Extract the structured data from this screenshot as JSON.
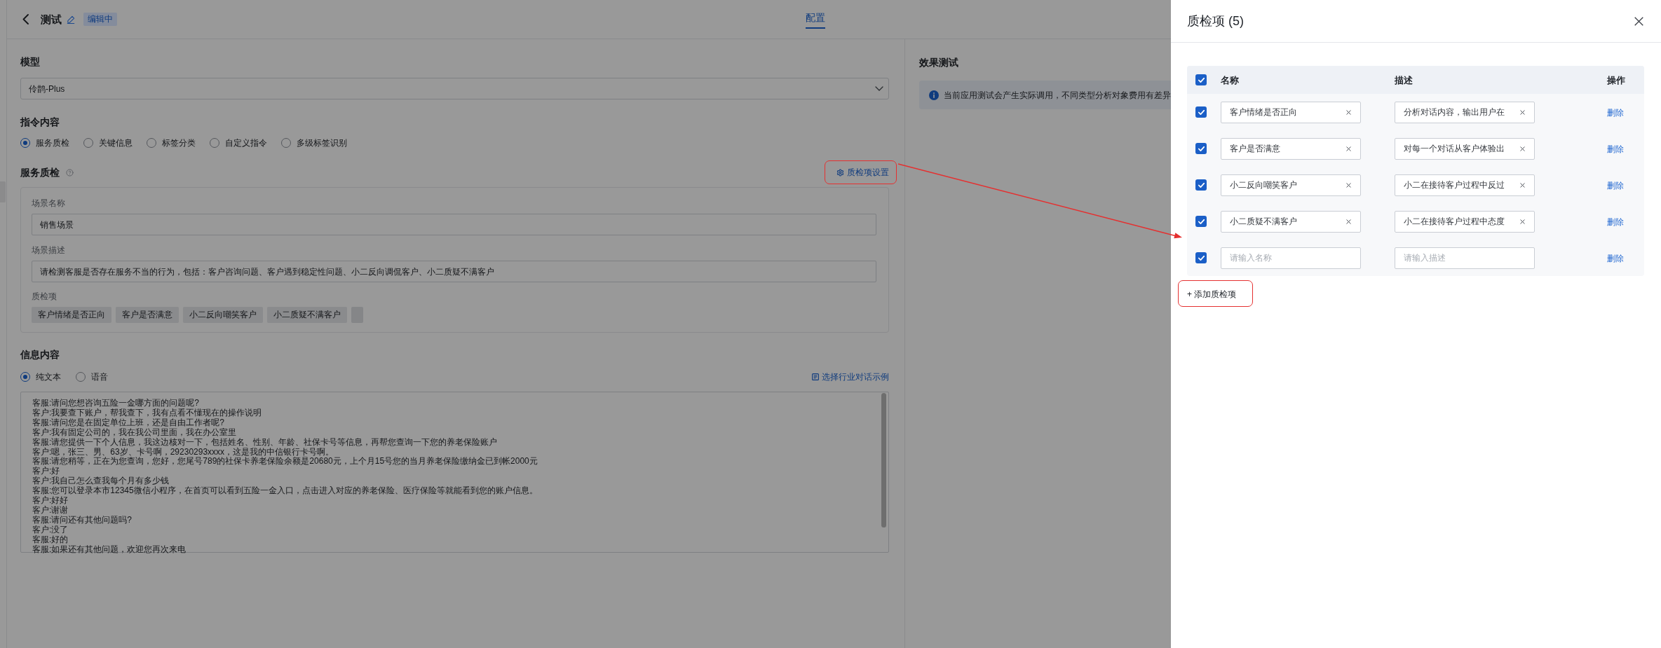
{
  "header": {
    "title": "测试",
    "badge": "编辑中",
    "tabs": [
      {
        "label": "配置",
        "selected": true
      }
    ]
  },
  "config": {
    "model": {
      "label": "模型",
      "value": "伶鹊-Plus"
    },
    "instruction": {
      "label": "指令内容",
      "options": [
        {
          "label": "服务质检",
          "selected": true
        },
        {
          "label": "关键信息",
          "selected": false
        },
        {
          "label": "标签分类",
          "selected": false
        },
        {
          "label": "自定义指令",
          "selected": false
        },
        {
          "label": "多级标签识别",
          "selected": false
        }
      ]
    },
    "service_qc": {
      "title": "服务质检",
      "settings_link": {
        "label": "质检项设置",
        "highlighted": true
      },
      "scene_name": {
        "label": "场景名称",
        "value": "销售场景"
      },
      "scene_description": {
        "label": "场景描述",
        "value": "请检测客服是否存在服务不当的行为，包括：客户咨询问题、客户遇到稳定性问题、小二反向调侃客户、小二质疑不满客户"
      },
      "items": {
        "label": "质检项",
        "tags": [
          {
            "kind": "text",
            "label": "客户情绪是否正向"
          },
          {
            "kind": "text",
            "label": "客户是否满意"
          },
          {
            "kind": "text",
            "label": "小二反向嘲笑客户"
          },
          {
            "kind": "text",
            "label": "小二质疑不满客户"
          },
          {
            "kind": "blank"
          }
        ]
      }
    },
    "message": {
      "label": "信息内容",
      "options": [
        {
          "label": "纯文本",
          "selected": true
        },
        {
          "label": "语音",
          "selected": false
        }
      ],
      "example_link": "选择行业对话示例",
      "dialogue": [
        "客服:请问您想咨询五险一金哪方面的问题呢?",
        "客户:我要查下账户，帮我查下，我有点看不懂现在的操作说明",
        "客服:请问您是在固定单位上班，还是自由工作者呢?",
        "客户:我有固定公司的，我在我公司里面，我在办公室里",
        "客服:请您提供一下个人信息，我这边核对一下，包括姓名、性别、年龄、社保卡号等信息，再帮您查询一下您的养老保险账户",
        "客户:嗯，张三、男、63岁、卡号啊，29230293xxxx，这是我的中信银行卡号啊。",
        "客服:请您稍等，正在为您查询，您好，您尾号789的社保卡养老保险余额是20680元，上个月15号您的当月养老保险缴纳金已到帐2000元",
        "客户:好",
        "客户:我自己怎么查我每个月有多少钱",
        "客服:您可以登录本市12345微信小程序，在首页可以看到五险一金入口，点击进入对应的养老保险、医疗保险等就能看到您的账户信息。",
        "客户:好好",
        "客户:谢谢",
        "客服:请问还有其他问题吗?",
        "客户:没了",
        "客服:好的",
        "客服:如果还有其他问题，欢迎您再次来电"
      ]
    }
  },
  "effect_test": {
    "title": "效果测试",
    "notice": "当前应用测试会产生实际调用，不同类型分析对象费用有差异"
  },
  "drawer": {
    "title": "质检项 (5)",
    "select_all": {
      "checked": true
    },
    "columns": [
      "名称",
      "描述",
      "操作"
    ],
    "rows": [
      {
        "checked": true,
        "name": {
          "value": "客户情绪是否正向"
        },
        "description": {
          "value": "分析对话内容，输出用户在"
        },
        "action": "删除"
      },
      {
        "checked": true,
        "name": {
          "value": "客户是否满意"
        },
        "description": {
          "value": "对每一个对话从客户体验出"
        },
        "action": "删除"
      },
      {
        "checked": true,
        "name": {
          "value": "小二反向嘲笑客户"
        },
        "description": {
          "value": "小二在接待客户过程中反过"
        },
        "action": "删除"
      },
      {
        "checked": true,
        "name": {
          "value": "小二质疑不满客户"
        },
        "description": {
          "value": "小二在接待客户过程中态度"
        },
        "action": "删除"
      },
      {
        "checked": true,
        "name": {
          "placeholder": "请输入名称"
        },
        "description": {
          "placeholder": "请输入描述"
        },
        "action": "删除"
      }
    ],
    "add_button": {
      "label": "+ 添加质检项",
      "highlighted": true
    }
  },
  "annotations": {
    "arrow": true
  }
}
